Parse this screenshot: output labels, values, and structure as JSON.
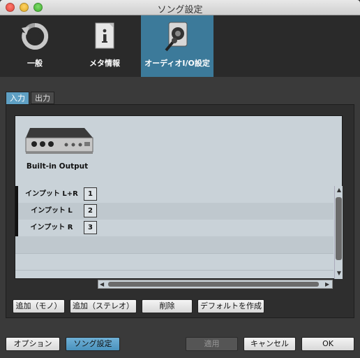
{
  "window": {
    "title": "ソング設定"
  },
  "toolbar": {
    "items": [
      {
        "label": "一般",
        "icon": "refresh-icon",
        "active": false
      },
      {
        "label": "メタ情報",
        "icon": "info-document-icon",
        "active": false
      },
      {
        "label": "オーディオI/O設定",
        "icon": "speaker-mic-icon",
        "active": true
      }
    ]
  },
  "tabs": {
    "input": "入力",
    "output": "出力"
  },
  "device": {
    "name": "Built-in Output"
  },
  "channels": [
    {
      "label": "インプット L+R",
      "number": "1"
    },
    {
      "label": "インプット L",
      "number": "2"
    },
    {
      "label": "インプット R",
      "number": "3"
    }
  ],
  "actions": {
    "add_mono": "追加（モノ）",
    "add_stereo": "追加（ステレオ）",
    "delete": "削除",
    "make_default": "デフォルトを作成"
  },
  "footer": {
    "options": "オプション",
    "song_settings": "ソング設定",
    "apply": "適用",
    "cancel": "キャンセル",
    "ok": "OK"
  },
  "colors": {
    "accent": "#3c7a9a",
    "list_bg": "#c9d2d8"
  }
}
